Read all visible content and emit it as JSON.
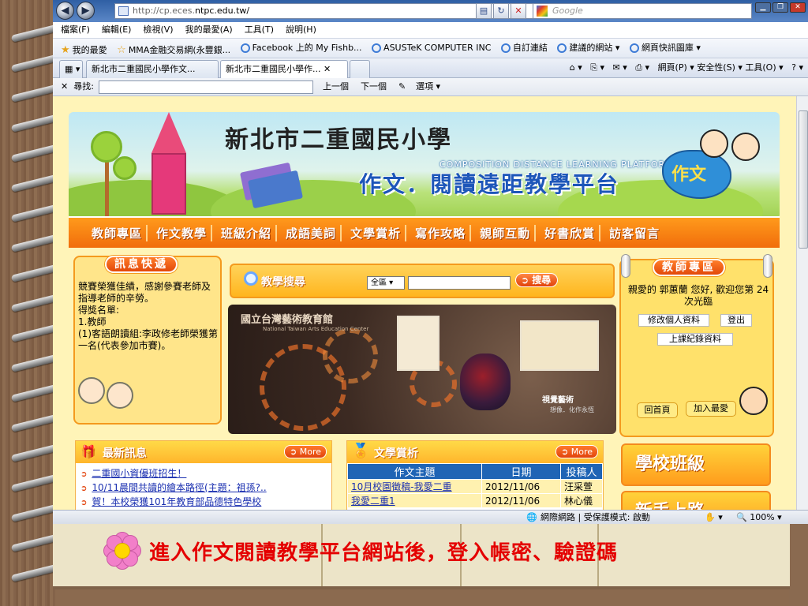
{
  "browser": {
    "url_prefix": "http://cp.eces.",
    "url_host": "ntpc.edu.tw/",
    "search_placeholder": "Google",
    "menu": [
      "檔案(F)",
      "編輯(E)",
      "檢視(V)",
      "我的最愛(A)",
      "工具(T)",
      "說明(H)"
    ],
    "favorites": [
      "我的最愛",
      "MMA金融交易網(永豐銀...",
      "Facebook 上的 My Fishb...",
      "ASUSTeK COMPUTER INC",
      "自訂連結",
      "建議的網站 ▾",
      "網頁快訊圖庫 ▾"
    ],
    "tabs": [
      "新北市二重國民小學作文...",
      "新北市二重國民小學作..."
    ],
    "commands": "網頁(P) ▾   安全性(S) ▾   工具(O) ▾",
    "find_label": "尋找:",
    "find_prev": "上一個",
    "find_next": "下一個",
    "find_options": "選項 ▾",
    "status_zone": "網際網路 | 受保護模式: 啟動",
    "zoom": "100%"
  },
  "site": {
    "school_name": "新北市二重國民小學",
    "platform_en": "COMPOSITION DISTANCE LEARNING PLATFORM",
    "platform_title": "作文．閱讀遠距教學平台",
    "badge_text": "作文",
    "nav": [
      "教師專區",
      "作文教學",
      "班級介紹",
      "成語美詞",
      "文學賞析",
      "寫作攻略",
      "親師互動",
      "好書欣賞",
      "訪客留言"
    ],
    "news_title": "訊息快遞",
    "news_text": "競賽榮獲佳績，感謝參賽老師及指導老師的辛勞。\n得獎名單:\n1.教師\n(1)客語朗讀組:李政修老師榮獲第一名(代表參加市賽)。",
    "search_title": "教學搜尋",
    "search_scope": "全區",
    "search_button": "搜尋",
    "museum_name": "國立台灣藝術教育館",
    "museum_name_en": "National Taiwan Arts Education Center",
    "museum_tag": "視覺藝術",
    "museum_subtag": "想像．化作永恆",
    "teacher_title": "教師專區",
    "welcome": "親愛的 郭蕙蘭 您好, 歡迎您第 24 次光臨",
    "edit_profile": "修改個人資料",
    "logout": "登出",
    "class_record": "上課紀錄資料",
    "home": "回首頁",
    "add_fav": "加入最愛",
    "latest_title": "最新訊息",
    "more": "More",
    "latest": [
      "二重國小資優班招生！",
      "10/11晨間共讀的繪本路徑(主題：祖孫?..",
      "賀！本校榮獲101年教育部品德特色學校"
    ],
    "lit_title": "文學賞析",
    "lit_headers": [
      "作文主題",
      "日期",
      "投稿人"
    ],
    "lit_rows": [
      [
        "10月校園徵稿-我愛二重",
        "2012/11/06",
        "汪采萱"
      ],
      [
        "我愛二重1",
        "2012/11/06",
        "林心儀"
      ]
    ],
    "side_buttons": [
      "學校班級",
      "新手上路"
    ]
  },
  "caption": "進入作文閱讀教學平台網站後，登入帳密、驗證碼",
  "colors": {
    "accent_orange": "#f16d0b",
    "title_blue": "#1d56b9",
    "caption_red": "#e40000"
  }
}
